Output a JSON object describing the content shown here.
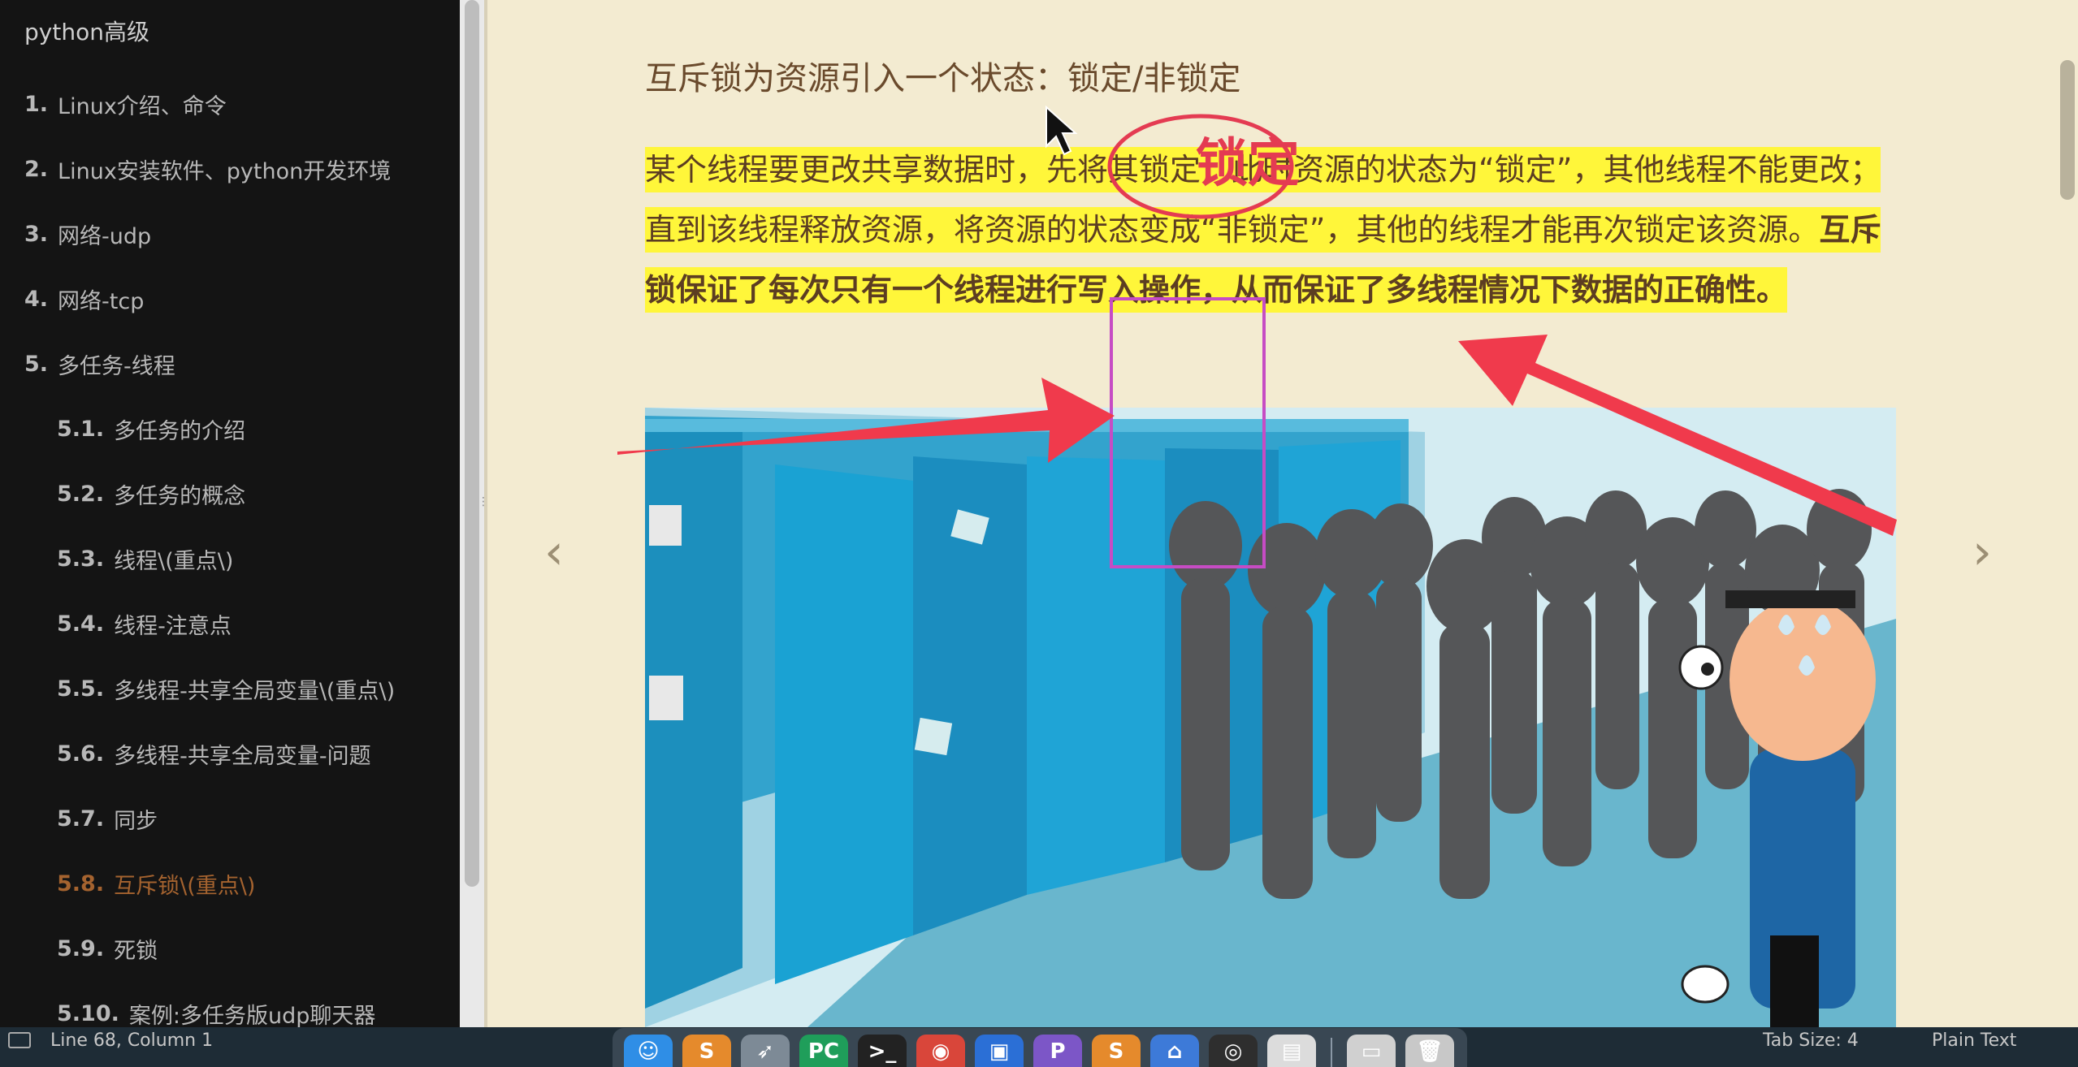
{
  "sidebar": {
    "book_title": "python高级",
    "items": [
      {
        "num": "1.",
        "label": "Linux介绍、命令"
      },
      {
        "num": "2.",
        "label": "Linux安装软件、python开发环境"
      },
      {
        "num": "3.",
        "label": "网络-udp"
      },
      {
        "num": "4.",
        "label": "网络-tcp"
      },
      {
        "num": "5.",
        "label": "多任务-线程"
      },
      {
        "num": "5.1.",
        "label": "多任务的介绍"
      },
      {
        "num": "5.2.",
        "label": "多任务的概念"
      },
      {
        "num": "5.3.",
        "label": "线程\\(重点\\)"
      },
      {
        "num": "5.4.",
        "label": "线程-注意点"
      },
      {
        "num": "5.5.",
        "label": "多线程-共享全局变量\\(重点\\)"
      },
      {
        "num": "5.6.",
        "label": "多线程-共享全局变量-问题"
      },
      {
        "num": "5.7.",
        "label": "同步"
      },
      {
        "num": "5.8.",
        "label": "互斥锁\\(重点\\)"
      },
      {
        "num": "5.9.",
        "label": "死锁"
      },
      {
        "num": "5.10.",
        "label": "案例:多任务版udp聊天器"
      }
    ]
  },
  "content": {
    "heading": "互斥锁为资源引入一个状态：锁定/非锁定",
    "paragraph_normal": "某个线程要更改共享数据时，先将其锁定，此时资源的状态为“锁定”，其他线程不能更改；直到该线程释放资源，将资源的状态变成“非锁定”，其他的线程才能再次锁定该资源。",
    "paragraph_bold": "互斥锁保证了每次只有一个线程进行写入操作，从而保证了多线程情况下数据的正确性。",
    "annotation_text": "锁定",
    "prev_arrow": "‹",
    "next_arrow": "›"
  },
  "statusbar": {
    "position": "Line 68, Column 1",
    "tab_size": "Tab Size: 4",
    "syntax": "Plain Text"
  },
  "dock": {
    "icons": [
      {
        "name": "finder-icon",
        "glyph": "☺",
        "color": "#2f8ee6"
      },
      {
        "name": "sublime-icon",
        "glyph": "S",
        "color": "#e58a2c"
      },
      {
        "name": "rocket-icon",
        "glyph": "➶",
        "color": "#7d8a96"
      },
      {
        "name": "pycharm-icon",
        "glyph": "PC",
        "color": "#1f9e5a"
      },
      {
        "name": "terminal-icon",
        "glyph": ">_",
        "color": "#222222"
      },
      {
        "name": "chrome-icon",
        "glyph": "◉",
        "color": "#d9463a"
      },
      {
        "name": "screenshot-icon",
        "glyph": "▣",
        "color": "#2b6fd6"
      },
      {
        "name": "p-app-icon",
        "glyph": "P",
        "color": "#7c56c7"
      },
      {
        "name": "sublime-icon-2",
        "glyph": "S",
        "color": "#e58a2c"
      },
      {
        "name": "keynote-icon",
        "glyph": "⌂",
        "color": "#3d7ad8"
      },
      {
        "name": "obs-icon",
        "glyph": "◎",
        "color": "#2e2e2e"
      },
      {
        "name": "preview-icon",
        "glyph": "▤",
        "color": "#dcdcdc"
      },
      {
        "name": "document-icon",
        "glyph": "▭",
        "color": "#d0d0d0"
      },
      {
        "name": "trash-icon",
        "glyph": "🗑",
        "color": "#c8c8c8"
      }
    ]
  }
}
